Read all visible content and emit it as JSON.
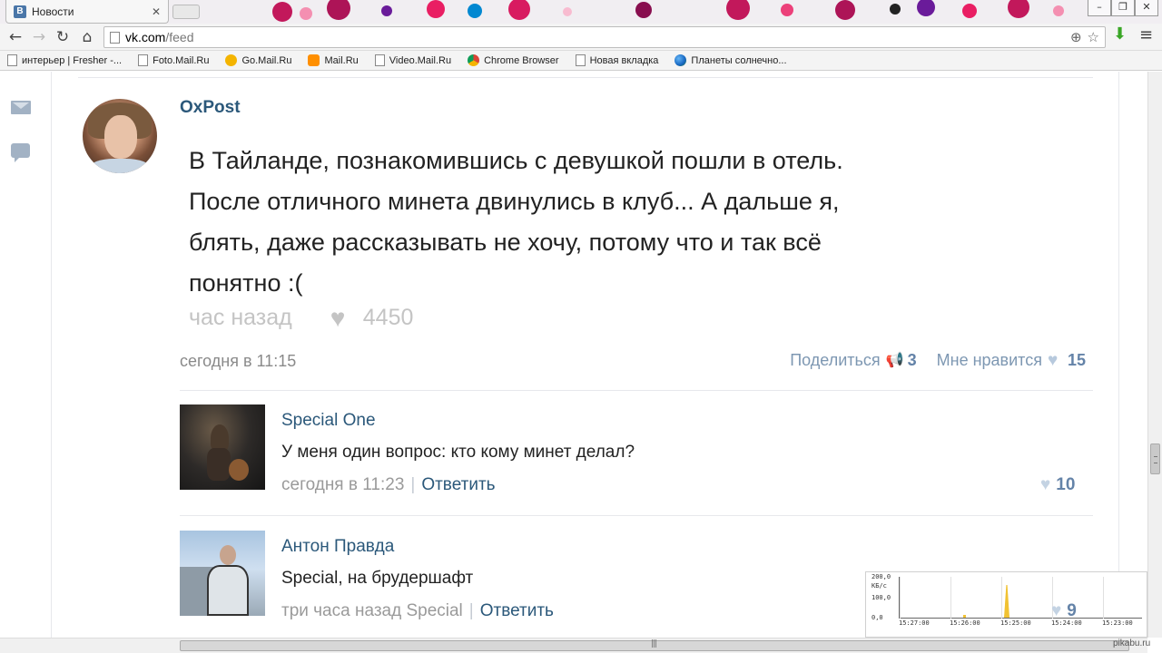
{
  "browser": {
    "tab_title": "Новости",
    "tab_favicon": "В",
    "url_host": "vk.com",
    "url_path": "/feed",
    "bookmarks": [
      {
        "label": "интерьер | Fresher -..."
      },
      {
        "label": "Foto.Mail.Ru"
      },
      {
        "label": "Go.Mail.Ru"
      },
      {
        "label": "Mail.Ru"
      },
      {
        "label": "Video.Mail.Ru"
      },
      {
        "label": "Chrome Browser"
      },
      {
        "label": "Новая вкладка"
      },
      {
        "label": "Планеты солнечно..."
      }
    ]
  },
  "post": {
    "author": "OxPost",
    "text_lines": [
      "В Тайланде, познакомившись с девушкой пошли в отель.",
      "После отличного минета двинулись в клуб... А дальше я,",
      "блять, даже рассказывать не хочу, потому что и так всё",
      "понятно :("
    ],
    "meta_time": "час назад",
    "meta_likes": "4450",
    "date": "сегодня в 11:15",
    "share_label": "Поделиться",
    "share_count": "3",
    "like_label": "Мне нравится",
    "like_count": "15"
  },
  "comments": [
    {
      "author": "Special One",
      "text": "У меня один вопрос: кто кому минет делал?",
      "date": "сегодня в 11:23",
      "pipe": "|",
      "reply": "Ответить",
      "likes": "10"
    },
    {
      "author": "Антон Правда",
      "text": "Special, на брудершафт",
      "date": "три часа назад Special",
      "pipe": "|",
      "reply": "Ответить",
      "likes": "9"
    }
  ],
  "traffic_widget": {
    "y_labels": [
      "200,0",
      "КБ/с",
      "100,0",
      "0,0"
    ],
    "x_labels": [
      "15:27:00",
      "15:26:00",
      "15:25:00",
      "15:24:00",
      "15:23:00"
    ]
  },
  "watermark": "pikabu.ru",
  "colors": {
    "link": "#2b587a",
    "accent": "#6483a8",
    "vk_brand": "#4a76a8"
  }
}
